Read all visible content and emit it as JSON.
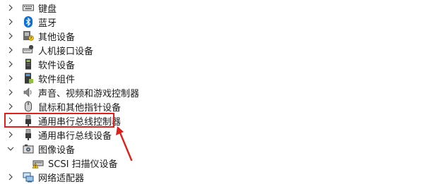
{
  "tree": {
    "items": [
      {
        "label": "键盘",
        "icon": "keyboard-icon",
        "expanded": false
      },
      {
        "label": "蓝牙",
        "icon": "bluetooth-icon",
        "expanded": false
      },
      {
        "label": "其他设备",
        "icon": "other-devices-icon",
        "expanded": false
      },
      {
        "label": "人机接口设备",
        "icon": "hid-icon",
        "expanded": false
      },
      {
        "label": "软件设备",
        "icon": "software-device-icon",
        "expanded": false
      },
      {
        "label": "软件组件",
        "icon": "software-component-icon",
        "expanded": false
      },
      {
        "label": "声音、视频和游戏控制器",
        "icon": "speaker-icon",
        "expanded": false
      },
      {
        "label": "鼠标和其他指针设备",
        "icon": "mouse-icon",
        "expanded": false
      },
      {
        "label": "通用串行总线控制器",
        "icon": "usb-icon",
        "expanded": false,
        "highlighted": true
      },
      {
        "label": "通用串行总线设备",
        "icon": "usb-icon",
        "expanded": false
      },
      {
        "label": "图像设备",
        "icon": "camera-icon",
        "expanded": true
      },
      {
        "label": "SCSI 扫描仪设备",
        "icon": "scanner-warning-icon",
        "child": true
      },
      {
        "label": "网络适配器",
        "icon": "network-icon",
        "expanded": false
      }
    ]
  },
  "colors": {
    "highlight": "#e0201b",
    "bluetooth": "#0a6fd8"
  }
}
